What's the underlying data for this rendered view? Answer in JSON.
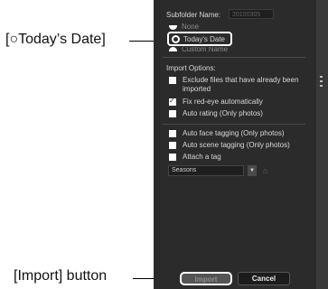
{
  "callouts": {
    "todays_date": "[○Today’s Date]",
    "import_button": "[Import] button"
  },
  "dialog": {
    "subfolder_label": "Subfolder Name:",
    "subfolder_value": "20100305",
    "subfolder_options": [
      "None",
      "Today's Date",
      "Custom Name"
    ],
    "subfolder_selected": "Today's Date",
    "import_options_label": "Import Options:",
    "options": [
      {
        "label": "Exclude files that have already been",
        "label2": "imported",
        "checked": false
      },
      {
        "label": "Fix red-eye automatically",
        "checked": true
      },
      {
        "label": "Auto rating (Only photos)",
        "checked": false
      },
      {
        "label": "Auto face tagging (Only photos)",
        "checked": false
      },
      {
        "label": "Auto scene tagging (Only photos)",
        "checked": false
      },
      {
        "label": "Attach a tag",
        "checked": false
      }
    ],
    "tag_dropdown_value": "Seasons",
    "dropdown_arrow_icon": "triangle-down-icon",
    "tag_icon": "tag-icon",
    "import_button": "Import",
    "cancel_button": "Cancel"
  }
}
